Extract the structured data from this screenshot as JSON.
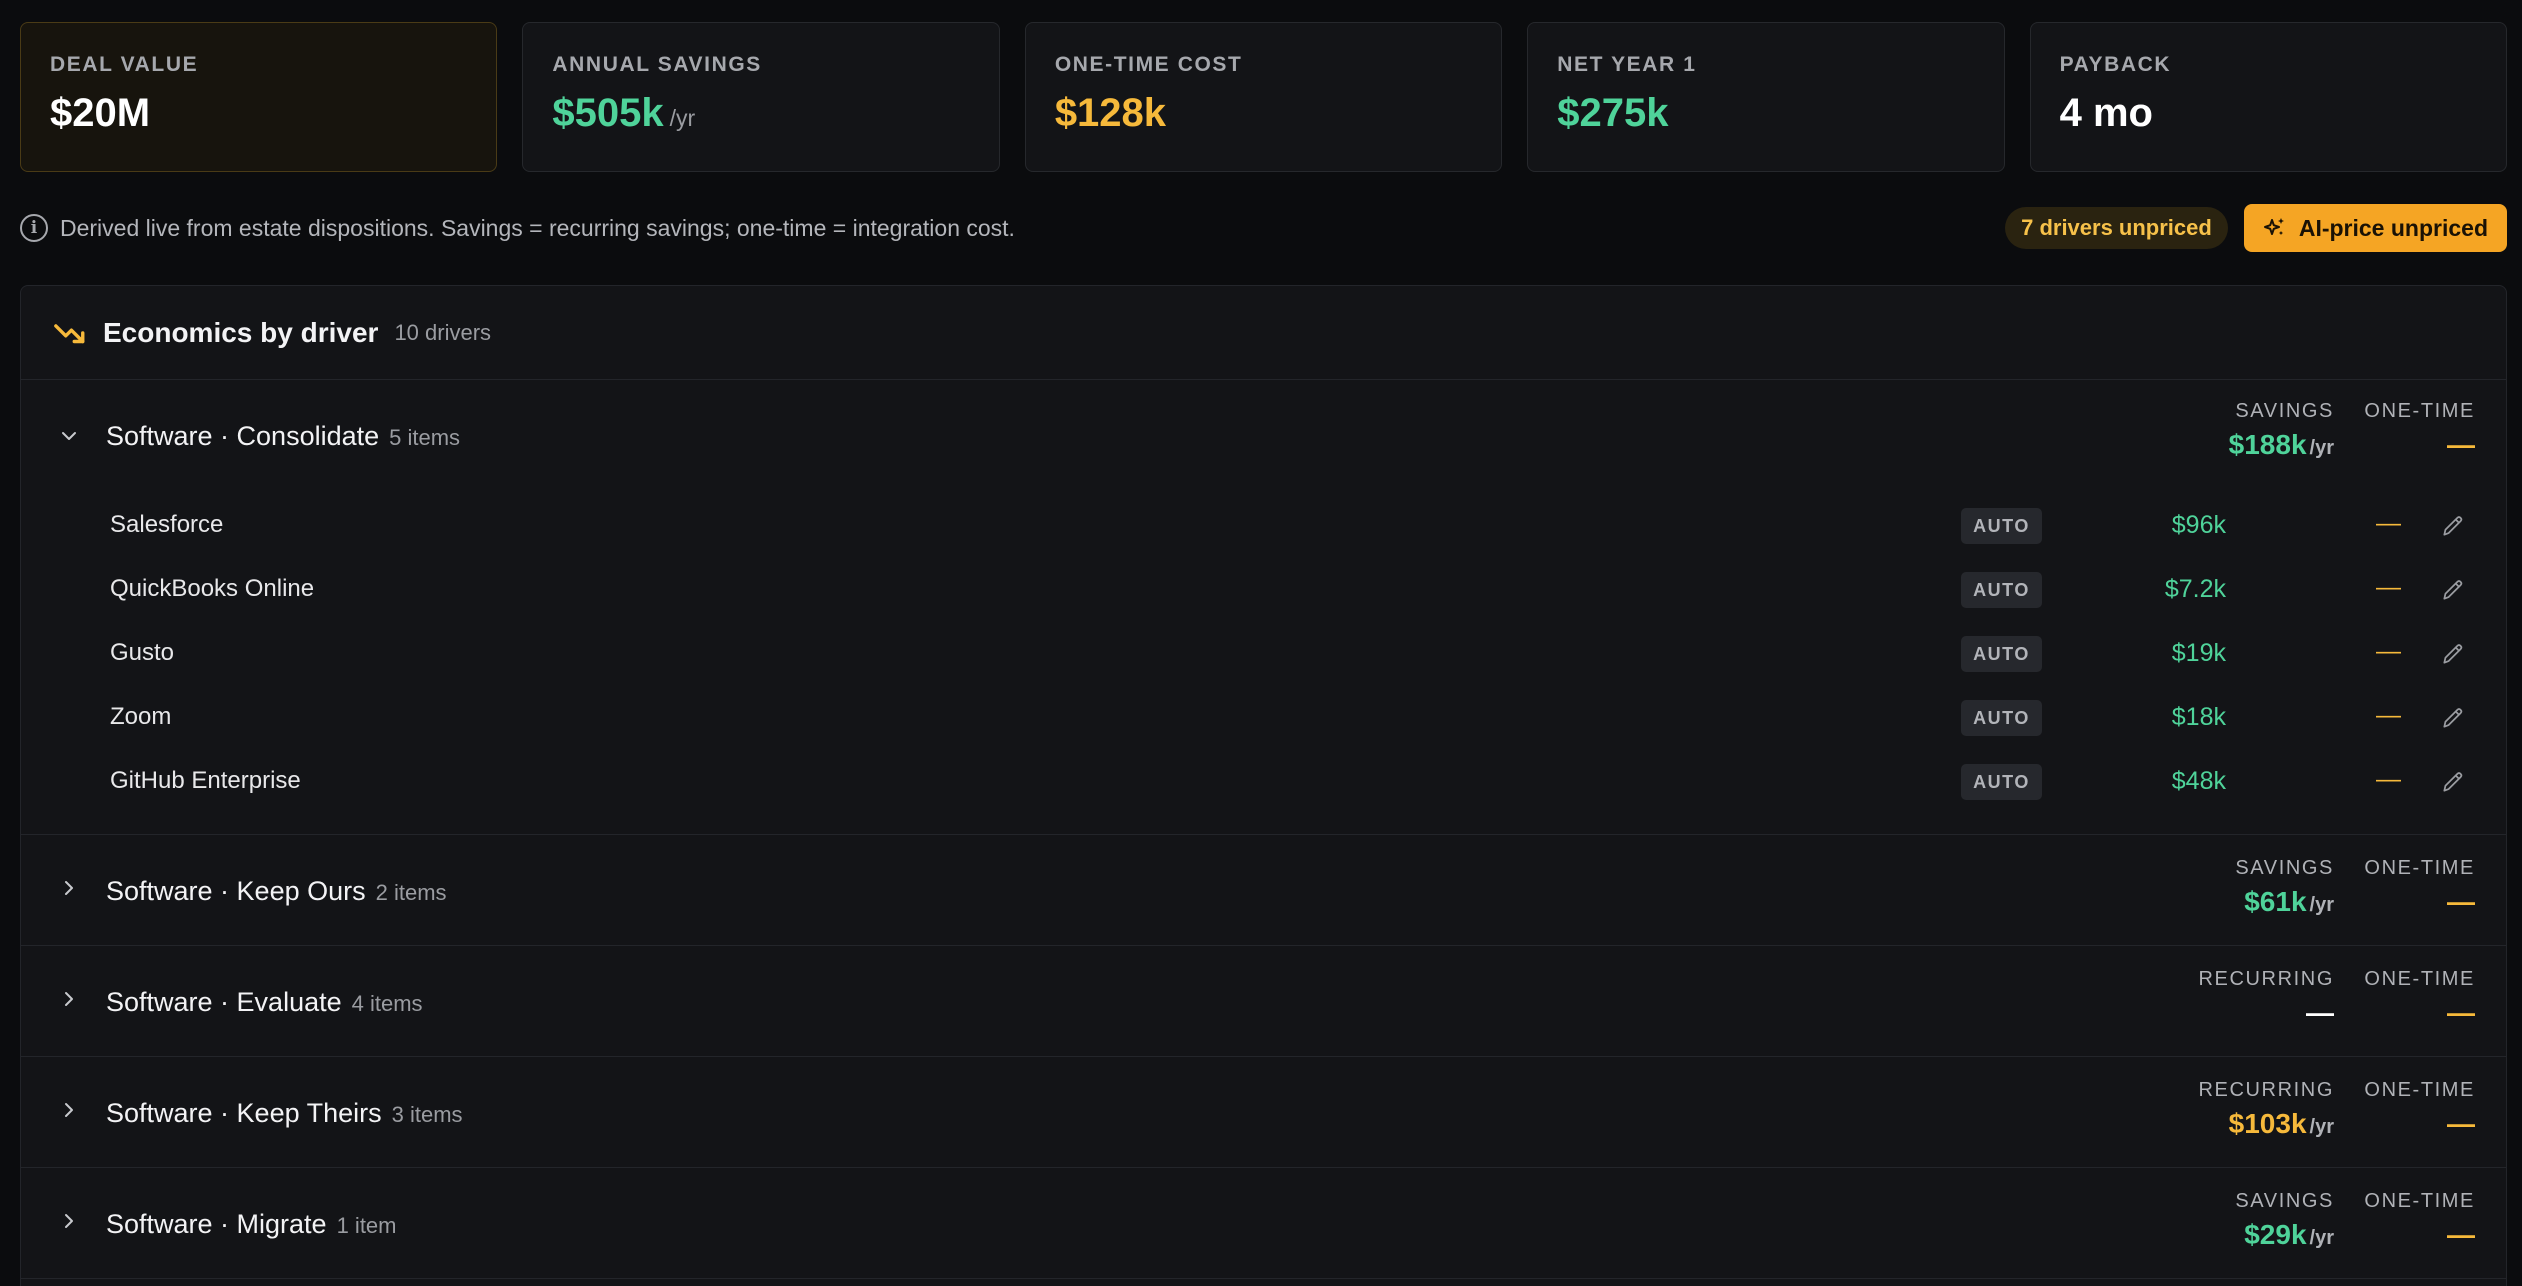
{
  "kpis": [
    {
      "label": "DEAL VALUE",
      "value": "$20M",
      "unit": "",
      "color": "#ffffff"
    },
    {
      "label": "ANNUAL SAVINGS",
      "value": "$505k",
      "unit": "/yr",
      "color": "#4fd39a"
    },
    {
      "label": "ONE-TIME COST",
      "value": "$128k",
      "unit": "",
      "color": "#f6b93b"
    },
    {
      "label": "NET YEAR 1",
      "value": "$275k",
      "unit": "",
      "color": "#4fd39a"
    },
    {
      "label": "PAYBACK",
      "value": "4 mo",
      "unit": "",
      "color": "#ffffff"
    }
  ],
  "info": {
    "icon": "info-icon",
    "text": "Derived live from estate dispositions.  Savings = recurring savings; one-time = integration cost.",
    "unpriced_badge": "7 drivers unpriced",
    "ai_button": "AI-price unpriced",
    "ai_icon": "sparkle-icon"
  },
  "panel": {
    "icon": "trending-down-icon",
    "title": "Economics by driver",
    "count": "10 drivers"
  },
  "groups": [
    {
      "name": "Software · Consolidate",
      "items_label": "5 items",
      "expanded": true,
      "col1_label": "SAVINGS",
      "col1_value": "$188k",
      "col1_unit": "/yr",
      "col1_color": "#4fd39a",
      "col2_label": "ONE-TIME",
      "col2_value": "—",
      "rows": [
        {
          "name": "Salesforce",
          "badge": "AUTO",
          "savings": "$96k",
          "onetime": "—"
        },
        {
          "name": "QuickBooks Online",
          "badge": "AUTO",
          "savings": "$7.2k",
          "onetime": "—"
        },
        {
          "name": "Gusto",
          "badge": "AUTO",
          "savings": "$19k",
          "onetime": "—"
        },
        {
          "name": "Zoom",
          "badge": "AUTO",
          "savings": "$18k",
          "onetime": "—"
        },
        {
          "name": "GitHub Enterprise",
          "badge": "AUTO",
          "savings": "$48k",
          "onetime": "—"
        }
      ]
    },
    {
      "name": "Software · Keep Ours",
      "items_label": "2 items",
      "expanded": false,
      "col1_label": "SAVINGS",
      "col1_value": "$61k",
      "col1_unit": "/yr",
      "col1_color": "#4fd39a",
      "col2_label": "ONE-TIME",
      "col2_value": "—"
    },
    {
      "name": "Software · Evaluate",
      "items_label": "4 items",
      "expanded": false,
      "col1_label": "RECURRING",
      "col1_value": "—",
      "col1_unit": "",
      "col1_color": "#ffffff",
      "col2_label": "ONE-TIME",
      "col2_value": "—"
    },
    {
      "name": "Software · Keep Theirs",
      "items_label": "3 items",
      "expanded": false,
      "col1_label": "RECURRING",
      "col1_value": "$103k",
      "col1_unit": "/yr",
      "col1_color": "#f6b93b",
      "col2_label": "ONE-TIME",
      "col2_value": "—"
    },
    {
      "name": "Software · Migrate",
      "items_label": "1 item",
      "expanded": false,
      "col1_label": "SAVINGS",
      "col1_value": "$29k",
      "col1_unit": "/yr",
      "col1_color": "#4fd39a",
      "col2_label": "ONE-TIME",
      "col2_value": "—"
    }
  ]
}
